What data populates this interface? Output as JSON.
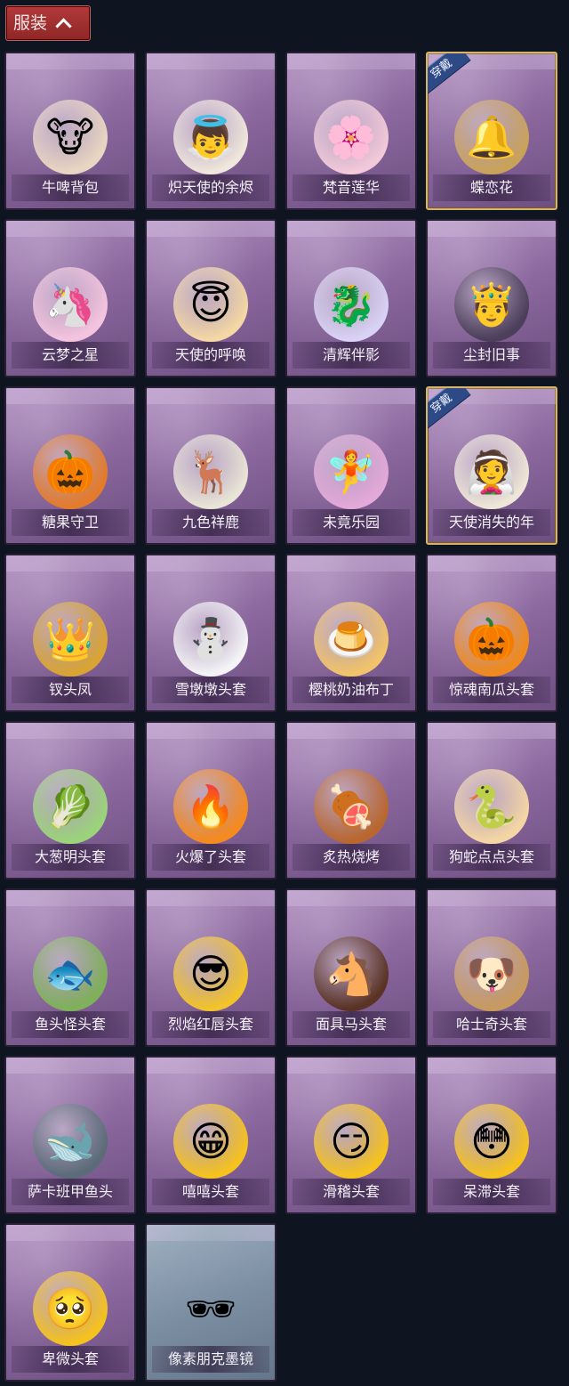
{
  "header": {
    "title": "服装"
  },
  "items": [
    {
      "name": "牛啤背包",
      "icon": "cow-beer-barrel-icon",
      "glyph": "🐮",
      "equipped": false,
      "color": "#e9d6c2"
    },
    {
      "name": "炽天使的余烬",
      "icon": "angel-girl-icon",
      "glyph": "👼",
      "equipped": false,
      "color": "#efe6dc"
    },
    {
      "name": "梵音莲华",
      "icon": "lotus-girl-icon",
      "glyph": "🌸",
      "equipped": false,
      "color": "#f1c9d8"
    },
    {
      "name": "蝶恋花",
      "icon": "butterfly-bell-icon",
      "glyph": "🔔",
      "equipped": true,
      "badge": "穿戴",
      "color": "#c9a25a"
    },
    {
      "name": "云梦之星",
      "icon": "unicorn-icon",
      "glyph": "🦄",
      "equipped": false,
      "color": "#f4c4de"
    },
    {
      "name": "天使的呼唤",
      "icon": "angel-boy-icon",
      "glyph": "😇",
      "equipped": false,
      "color": "#f3d7a4"
    },
    {
      "name": "清辉伴影",
      "icon": "dragon-girl-icon",
      "glyph": "🐉",
      "equipped": false,
      "color": "#d8d2f4"
    },
    {
      "name": "尘封旧事",
      "icon": "dark-prince-icon",
      "glyph": "🤴",
      "equipped": false,
      "color": "#4b3f5a"
    },
    {
      "name": "糖果守卫",
      "icon": "pumpkin-scarecrow-icon",
      "glyph": "🎃",
      "equipped": false,
      "color": "#e47b2a"
    },
    {
      "name": "九色祥鹿",
      "icon": "deer-icon",
      "glyph": "🦌",
      "equipped": false,
      "color": "#e8e4d6"
    },
    {
      "name": "未竟乐园",
      "icon": "fairy-girl-icon",
      "glyph": "🧚",
      "equipped": false,
      "color": "#e3a9d8"
    },
    {
      "name": "天使消失的年",
      "icon": "veiled-angel-icon",
      "glyph": "👰",
      "equipped": true,
      "badge": "穿戴",
      "color": "#eee6d6"
    },
    {
      "name": "钗头凤",
      "icon": "phoenix-crown-icon",
      "glyph": "👑",
      "equipped": false,
      "color": "#d9a432"
    },
    {
      "name": "雪墩墩头套",
      "icon": "snowman-head-icon",
      "glyph": "⛄",
      "equipped": false,
      "color": "#f4f4f6"
    },
    {
      "name": "樱桃奶油布丁",
      "icon": "pudding-icon",
      "glyph": "🍮",
      "equipped": false,
      "color": "#f1c36a"
    },
    {
      "name": "惊魂南瓜头套",
      "icon": "pumpkin-head-icon",
      "glyph": "🎃",
      "equipped": false,
      "color": "#f08a1c"
    },
    {
      "name": "大葱明头套",
      "icon": "scallion-head-icon",
      "glyph": "🥬",
      "equipped": false,
      "color": "#9bd37a"
    },
    {
      "name": "火爆了头套",
      "icon": "fire-head-icon",
      "glyph": "🔥",
      "equipped": false,
      "color": "#f58a1e"
    },
    {
      "name": "炙热烧烤",
      "icon": "bbq-meat-icon",
      "glyph": "🍖",
      "equipped": false,
      "color": "#b9672e"
    },
    {
      "name": "狗蛇点点头套",
      "icon": "snake-head-icon",
      "glyph": "🐍",
      "equipped": false,
      "color": "#f4d6a4"
    },
    {
      "name": "鱼头怪头套",
      "icon": "fish-head-icon",
      "glyph": "🐟",
      "equipped": false,
      "color": "#7fb05a"
    },
    {
      "name": "烈焰红唇头套",
      "icon": "pikachu-head-icon",
      "glyph": "😎",
      "equipped": false,
      "color": "#f2c32a"
    },
    {
      "name": "面具马头套",
      "icon": "horse-head-icon",
      "glyph": "🐴",
      "equipped": false,
      "color": "#5a3324"
    },
    {
      "name": "哈士奇头套",
      "icon": "husky-head-icon",
      "glyph": "🐶",
      "equipped": false,
      "color": "#c89a5e"
    },
    {
      "name": "萨卡班甲鱼头",
      "icon": "sacabambaspis-icon",
      "glyph": "🐋",
      "equipped": false,
      "color": "#5b6b78"
    },
    {
      "name": "嘻嘻头套",
      "icon": "grin-face-icon",
      "glyph": "😁",
      "equipped": false,
      "color": "#f5c21e"
    },
    {
      "name": "滑稽头套",
      "icon": "funny-face-icon",
      "glyph": "😏",
      "equipped": false,
      "color": "#f5c21e"
    },
    {
      "name": "呆滞头套",
      "icon": "dazed-face-icon",
      "glyph": "😳",
      "equipped": false,
      "color": "#f5c21e"
    },
    {
      "name": "卑微头套",
      "icon": "humble-face-icon",
      "glyph": "🥺",
      "equipped": false,
      "color": "#f5c21e"
    },
    {
      "name": "像素朋克墨镜",
      "icon": "pixel-sunglasses-icon",
      "glyph": "🕶",
      "equipped": false,
      "plain": true,
      "color": "#111111"
    }
  ]
}
